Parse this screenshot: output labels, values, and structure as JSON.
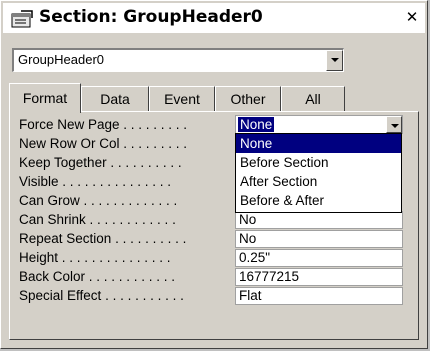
{
  "window": {
    "title": "Section: GroupHeader0",
    "close_glyph": "✕"
  },
  "object_selector": {
    "value": "GroupHeader0"
  },
  "tabs": [
    {
      "label": "Format",
      "active": true
    },
    {
      "label": "Data"
    },
    {
      "label": "Event"
    },
    {
      "label": "Other"
    },
    {
      "label": "All"
    }
  ],
  "properties": [
    {
      "label": "Force New Page",
      "dots": " . . . . . . . . .",
      "value": "None",
      "control": "combo"
    },
    {
      "label": "New Row Or Col",
      "dots": " . . . . . . . . .",
      "value": ""
    },
    {
      "label": "Keep Together",
      "dots": " . . . . . . . . . .",
      "value": ""
    },
    {
      "label": "Visible",
      "dots": " . . . . . . . . . . . . . . .",
      "value": ""
    },
    {
      "label": "Can Grow",
      "dots": " . . . . . . . . . . . . .",
      "value": ""
    },
    {
      "label": "Can Shrink",
      "dots": " . . . . . . . . . . . .",
      "value": "No"
    },
    {
      "label": "Repeat Section",
      "dots": " . . . . . . . . . .",
      "value": "No"
    },
    {
      "label": "Height",
      "dots": " . . . . . . . . . . . . . . .",
      "value": "0.25\""
    },
    {
      "label": "Back Color",
      "dots": " . . . . . . . . . . . .",
      "value": "16777215"
    },
    {
      "label": "Special Effect",
      "dots": " . . . . . . . . . . .",
      "value": "Flat"
    }
  ],
  "dropdown_options": [
    {
      "label": "None",
      "selected": true
    },
    {
      "label": "Before Section"
    },
    {
      "label": "After Section"
    },
    {
      "label": "Before & After"
    }
  ],
  "colors": {
    "face": "#d4d0c8",
    "highlight": "#000080"
  }
}
